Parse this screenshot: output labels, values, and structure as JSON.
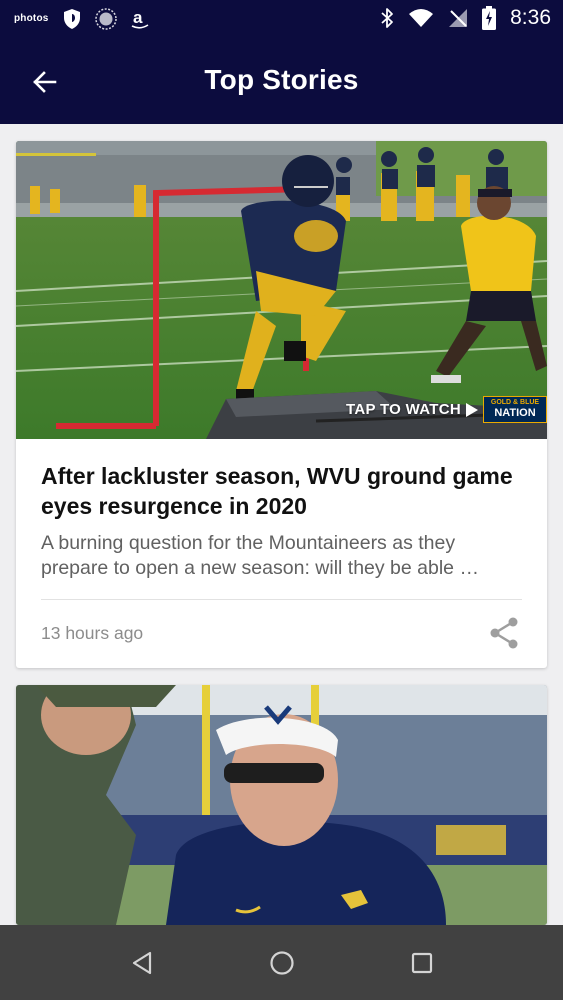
{
  "status_bar": {
    "photos_label": "photos",
    "time": "8:36",
    "icons": [
      "amazon-photos-icon",
      "shield-icon",
      "vpn-circle-icon",
      "amazon-icon",
      "bluetooth-icon",
      "wifi-icon",
      "no-signal-icon",
      "battery-charging-icon"
    ]
  },
  "app_bar": {
    "title": "Top Stories",
    "back_icon": "arrow-back-icon"
  },
  "stories": [
    {
      "title": "After lackluster season, WVU ground game eyes resurgence in 2020",
      "summary": "A burning question for the Mountaineers as they prepare to open a new season: will they be able …",
      "time": "13 hours ago",
      "overlay_text": "TAP TO WATCH",
      "badge_top": "GOLD & BLUE",
      "badge_bottom": "NATION",
      "share_icon": "share-icon"
    },
    {
      "title": "",
      "image": "coach-photo"
    }
  ],
  "nav_bar": {
    "icons": [
      "back-triangle-icon",
      "home-circle-icon",
      "recents-square-icon"
    ]
  },
  "colors": {
    "app_bar": "#0c0c3e",
    "background": "#efeff1",
    "nav_bar": "#414141",
    "wvu_gold": "#eaaa00",
    "wvu_blue": "#002855"
  }
}
